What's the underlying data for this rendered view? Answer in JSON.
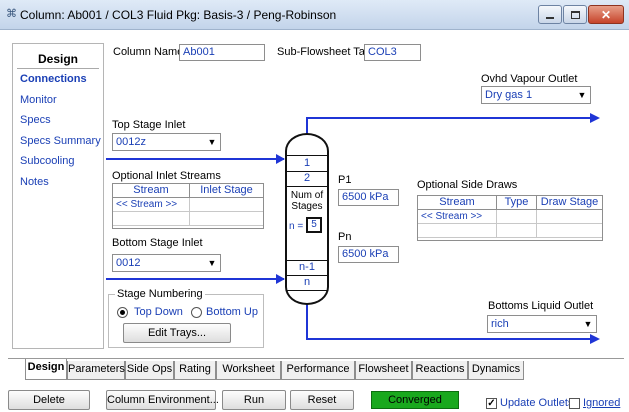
{
  "window": {
    "title": "Column: Ab001 / COL3  Fluid Pkg: Basis-3 / Peng-Robinson"
  },
  "nav": {
    "header": "Design",
    "items": [
      "Connections",
      "Monitor",
      "Specs",
      "Specs Summary",
      "Subcooling",
      "Notes"
    ],
    "active_index": 0
  },
  "form": {
    "column_name_label": "Column Name",
    "column_name_value": "Ab001",
    "subflowsheet_label": "Sub-Flowsheet Tag",
    "subflowsheet_value": "COL3",
    "top_stage_inlet_label": "Top Stage Inlet",
    "top_stage_inlet_value": "0012z",
    "optional_inlet_label": "Optional Inlet Streams",
    "inlet_cols": [
      "Stream",
      "Inlet Stage"
    ],
    "inlet_row": "<< Stream >>",
    "bottom_stage_inlet_label": "Bottom Stage Inlet",
    "bottom_stage_inlet_value": "0012",
    "stage_numbering_label": "Stage Numbering",
    "top_down_label": "Top Down",
    "bottom_up_label": "Bottom Up",
    "edit_trays_label": "Edit Trays...",
    "ovhd_label": "Ovhd Vapour Outlet",
    "ovhd_value": "Dry gas 1",
    "side_draws_label": "Optional Side Draws",
    "side_cols": [
      "Stream",
      "Type",
      "Draw Stage"
    ],
    "side_row": "<< Stream >>",
    "bottoms_label": "Bottoms Liquid Outlet",
    "bottoms_value": "rich",
    "p1_label": "P1",
    "p1_value": "6500 kPa",
    "pn_label": "Pn",
    "pn_value": "6500 kPa"
  },
  "column": {
    "stage_top1": "1",
    "stage_top2": "2",
    "num_stages_label1": "Num of",
    "num_stages_label2": "Stages",
    "n_label": "n =",
    "n_value": "5",
    "stage_bot1": "n-1",
    "stage_bot2": "n"
  },
  "tabs": [
    "Design",
    "Parameters",
    "Side Ops",
    "Rating",
    "Worksheet",
    "Performance",
    "Flowsheet",
    "Reactions",
    "Dynamics"
  ],
  "active_tab": 0,
  "buttons": {
    "delete": "Delete",
    "column_env": "Column Environment...",
    "run": "Run",
    "reset": "Reset"
  },
  "status": "Converged",
  "update_outlets_label": "Update Outlets",
  "ignored_label": "Ignored",
  "update_outlets_checked": true,
  "ignored_checked": false,
  "colors": {
    "link": "#1a3fb5",
    "stream": "#1f35d6",
    "status": "#19a81d"
  }
}
